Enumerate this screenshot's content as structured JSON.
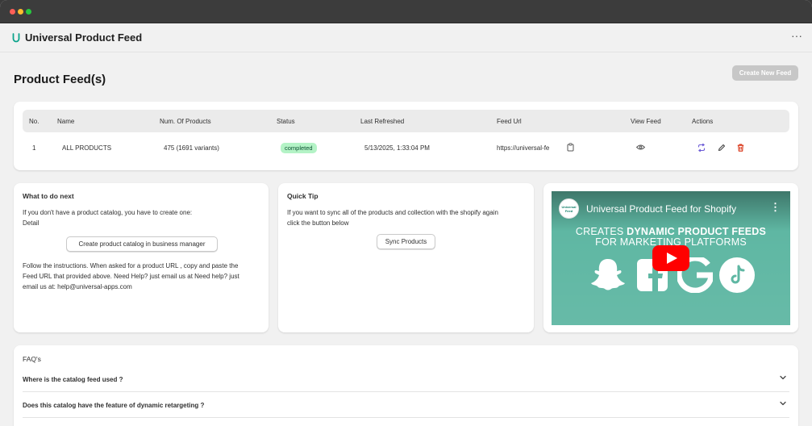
{
  "app": {
    "title": "Universal Product Feed",
    "menu_icon": "more-horizontal-icon"
  },
  "page": {
    "title": "Product Feed(s)",
    "create_label": "Create New Feed"
  },
  "table": {
    "headers": [
      "No.",
      "Name",
      "Num. Of Products",
      "Status",
      "Last Refreshed",
      "Feed Url",
      "View Feed",
      "Actions"
    ],
    "rows": [
      {
        "no": "1",
        "name": "ALL PRODUCTS",
        "products": "475 (1691 variants)",
        "status": "completed",
        "refreshed": "5/13/2025, 1:33:04 PM",
        "feed_url": "https://universal-fe"
      }
    ]
  },
  "next": {
    "title": "What to do next",
    "line1": "If you don't have a product catalog, you have to create one:",
    "line2": "Detail",
    "button": "Create product catalog in business manager",
    "para": [
      "Follow the instructions. When asked for a product URL , copy and paste the",
      "Feed URL that provided above. Need Help? just email us at Need help? just",
      "email us at: help@universal-apps.com"
    ]
  },
  "tip": {
    "title": "Quick Tip",
    "lines": [
      "If you want to sync all of the products and collection with the shopify again",
      "click the button below"
    ],
    "button": "Sync Products"
  },
  "video": {
    "title": "Universal Product Feed for Shopify",
    "head_a": "CREATES ",
    "head_b": "DYNAMIC PRODUCT FEEDS",
    "head_c": "FOR MARKETING PLATFORMS",
    "logo_text": "Universal Feed"
  },
  "faq": {
    "title": "FAQ's",
    "items": [
      "Where is the catalog feed used ?",
      "Does this catalog have the feature of dynamic retargeting ?"
    ]
  },
  "colors": {
    "status_bg": "#b4f3c6",
    "sync_icon": "#6b5bd6",
    "delete_icon": "#d72c0d",
    "video_bg": "#5fb7a3",
    "logo_accent": "#0ba38b"
  }
}
